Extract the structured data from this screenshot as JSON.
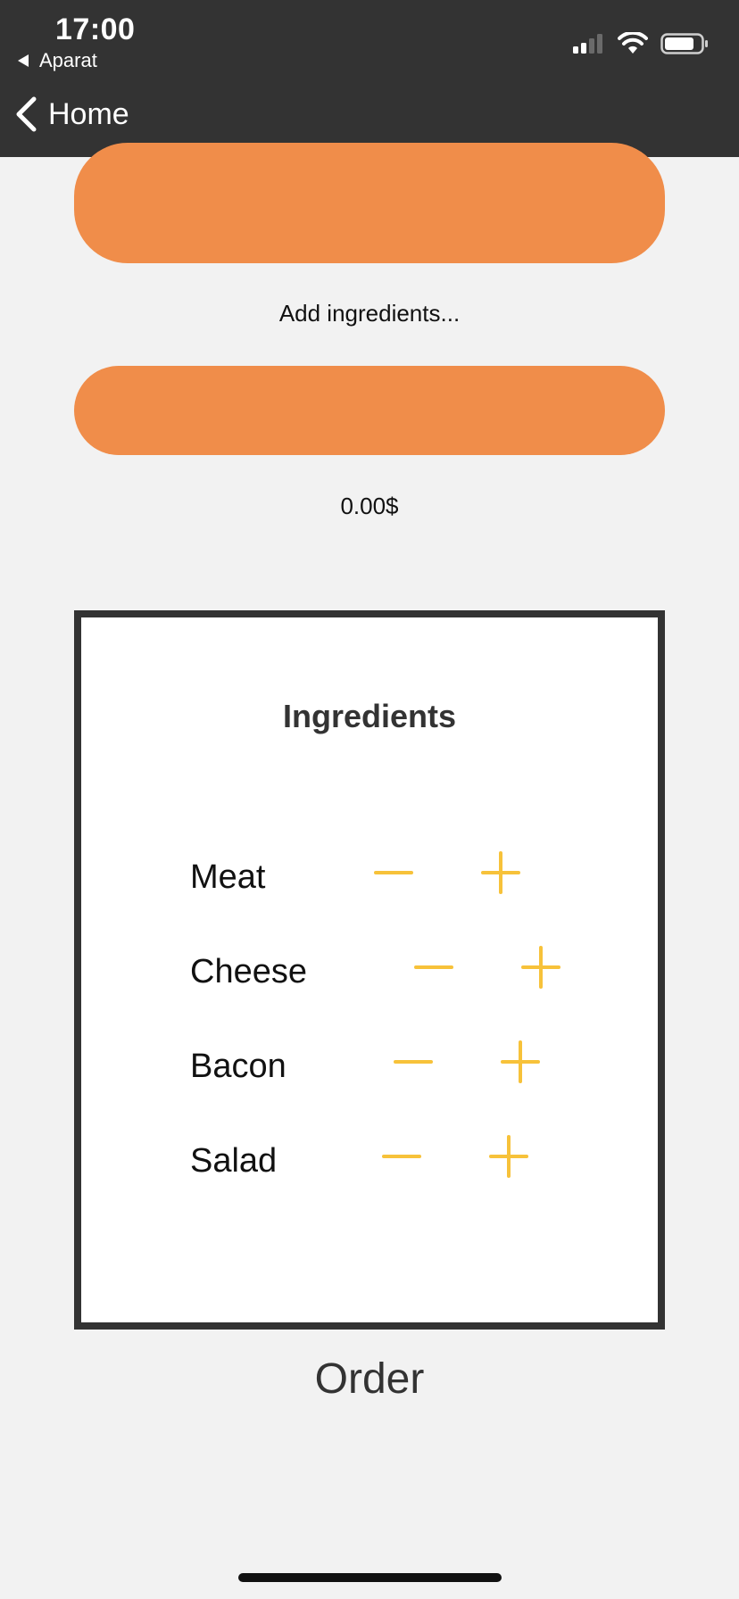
{
  "status_bar": {
    "time": "17:00",
    "back_app_label": "Aparat",
    "icons": [
      "signal-icon",
      "wifi-icon",
      "battery-icon"
    ]
  },
  "nav": {
    "back_label": "Home"
  },
  "main": {
    "add_ingredients_text": "Add ingredients...",
    "price_text": "0.00$"
  },
  "ingredients_panel": {
    "title": "Ingredients",
    "items": [
      {
        "label": "Meat"
      },
      {
        "label": "Cheese"
      },
      {
        "label": "Bacon"
      },
      {
        "label": "Salad"
      }
    ]
  },
  "order": {
    "label": "Order"
  },
  "colors": {
    "top_bar": "#333333",
    "accent_orange": "#f08d4a",
    "control_yellow": "#f7c23a",
    "background": "#f2f2f2"
  }
}
